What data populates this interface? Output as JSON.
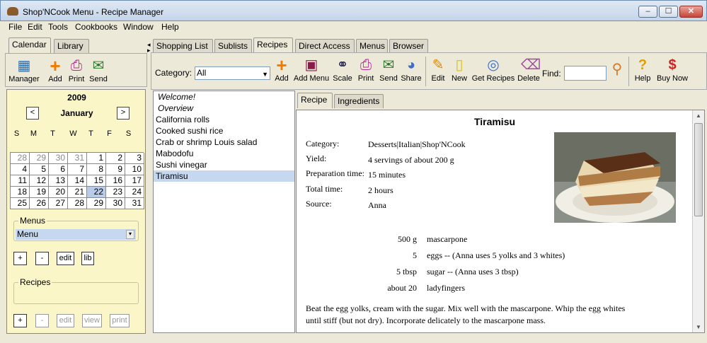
{
  "window": {
    "title": "Shop'NCook Menu - Recipe Manager",
    "min": "–",
    "max": "☐",
    "close": "✕"
  },
  "menubar": [
    "File",
    "Edit",
    "Tools",
    "Cookbooks",
    "Window",
    "Help"
  ],
  "left": {
    "tabs": [
      "Calendar",
      "Library"
    ],
    "toolbar": [
      {
        "label": "Manager",
        "icon": "calendar-manager-icon"
      },
      {
        "label": "Add",
        "icon": "add-icon"
      },
      {
        "label": "Print",
        "icon": "printer-icon"
      },
      {
        "label": "Send",
        "icon": "send-icon"
      }
    ],
    "calendar": {
      "year": "2009",
      "month": "January",
      "prev": "<",
      "next": ">",
      "day_names": [
        "S",
        "M",
        "T",
        "W",
        "T",
        "F",
        "S"
      ],
      "weeks": [
        [
          "28",
          "29",
          "30",
          "31",
          "1",
          "2",
          "3"
        ],
        [
          "4",
          "5",
          "6",
          "7",
          "8",
          "9",
          "10"
        ],
        [
          "11",
          "12",
          "13",
          "14",
          "15",
          "16",
          "17"
        ],
        [
          "18",
          "19",
          "20",
          "21",
          "22",
          "23",
          "24"
        ],
        [
          "25",
          "26",
          "27",
          "28",
          "29",
          "30",
          "31"
        ]
      ],
      "selected_day": "22"
    },
    "menus_group": {
      "title": "Menus",
      "items": [
        "Menu"
      ],
      "buttons": [
        "+",
        "-",
        "edit",
        "lib"
      ]
    },
    "recipes_group": {
      "title": "Recipes",
      "buttons": [
        "+",
        "-",
        "edit",
        "view",
        "print"
      ]
    }
  },
  "right": {
    "tabs": [
      "Shopping List",
      "Sublists",
      "Recipes",
      "Direct Access",
      "Menus",
      "Browser"
    ],
    "active_tab": "Recipes",
    "category_label": "Category:",
    "category_value": "All",
    "toolbar": [
      {
        "label": "Add",
        "icon": "add-icon"
      },
      {
        "label": "Add Menu",
        "icon": "add-menu-icon"
      },
      {
        "label": "Scale",
        "icon": "glasses-icon"
      },
      {
        "label": "Print",
        "icon": "printer-icon"
      },
      {
        "label": "Send",
        "icon": "send-icon"
      },
      {
        "label": "Share",
        "icon": "share-icon"
      },
      {
        "label": "Edit",
        "icon": "edit-icon"
      },
      {
        "label": "New",
        "icon": "new-icon"
      },
      {
        "label": "Get Recipes",
        "icon": "get-recipes-icon"
      },
      {
        "label": "Delete",
        "icon": "eraser-icon"
      }
    ],
    "find_label": "Find:",
    "find_value": "",
    "help": {
      "label": "Help",
      "icon": "help-icon"
    },
    "buy": {
      "label": "Buy Now",
      "icon": "dollar-icon"
    },
    "recipe_list": [
      {
        "label": "Welcome!",
        "italic": true
      },
      {
        "label": "Overview",
        "italic": true
      },
      {
        "label": "California rolls"
      },
      {
        "label": "Cooked sushi rice"
      },
      {
        "label": "Crab or shrimp Louis salad"
      },
      {
        "label": "Mabodofu"
      },
      {
        "label": "Sushi vinegar"
      },
      {
        "label": "Tiramisu",
        "selected": true
      }
    ],
    "detail_tabs": [
      "Recipe",
      "Ingredients"
    ],
    "recipe": {
      "title": "Tiramisu",
      "fields": [
        {
          "label": "Category:",
          "value": "Desserts|Italian|Shop'NCook"
        },
        {
          "label": "Yield:",
          "value": "4  servings  of about 200 g"
        },
        {
          "label": "Preparation time:",
          "value": "15 minutes"
        },
        {
          "label": "Total time:",
          "value": "2 hours"
        },
        {
          "label": "Source:",
          "value": "Anna"
        }
      ],
      "ingredients": [
        {
          "qty": "500 g",
          "text": "mascarpone"
        },
        {
          "qty": "5",
          "text": "eggs -- (Anna uses 5 yolks and 3 whites)"
        },
        {
          "qty": "5 tbsp",
          "text": "sugar -- (Anna uses 3 tbsp)"
        },
        {
          "qty": "about 20",
          "text": "ladyfingers"
        }
      ],
      "instructions": "Beat the egg yolks, cream with the sugar. Mix well with the mascarpone. Whip the egg whites until stiff (but not dry). Incorporate delicately to the mascarpone mass."
    }
  }
}
